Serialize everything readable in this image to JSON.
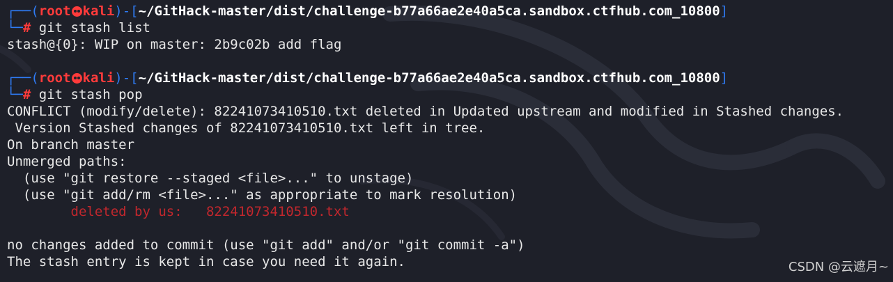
{
  "prompt1": {
    "open": "┌──(",
    "user": "root",
    "host": "kali",
    "mid": ")-[",
    "path": "~/GitHack-master/dist/challenge-b77a66ae2e40a5ca.sandbox.ctfhub.com_10800",
    "close": "]",
    "corner": "└─",
    "hash": "#",
    "command": "git stash list"
  },
  "output1": [
    "stash@{0}: WIP on master: 2b9c02b add flag"
  ],
  "prompt2": {
    "open": "┌──(",
    "user": "root",
    "host": "kali",
    "mid": ")-[",
    "path": "~/GitHack-master/dist/challenge-b77a66ae2e40a5ca.sandbox.ctfhub.com_10800",
    "close": "]",
    "corner": "└─",
    "hash": "#",
    "command": "git stash pop"
  },
  "output2": [
    "CONFLICT (modify/delete): 82241073410510.txt deleted in Updated upstream and modified in Stashed changes.",
    " Version Stashed changes of 82241073410510.txt left in tree.",
    "On branch master",
    "Unmerged paths:",
    "  (use \"git restore --staged <file>...\" to unstage)",
    "  (use \"git add/rm <file>...\" as appropriate to mark resolution)",
    "        deleted by us:   82241073410510.txt",
    "",
    "no changes added to commit (use \"git add\" and/or \"git commit -a\")",
    "The stash entry is kept in case you need it again."
  ],
  "watermark": "CSDN @云遮月~",
  "colors": {
    "background": "#1e2029",
    "prompt_frame": "#2f7cf6",
    "user_host": "#ff3b3b",
    "path": "#ffffff",
    "deleted": "#c1272d",
    "text": "#e8e8e8"
  },
  "icons": {
    "prompt_separator": "skull-icon",
    "background": "kali-dragon-logo"
  }
}
